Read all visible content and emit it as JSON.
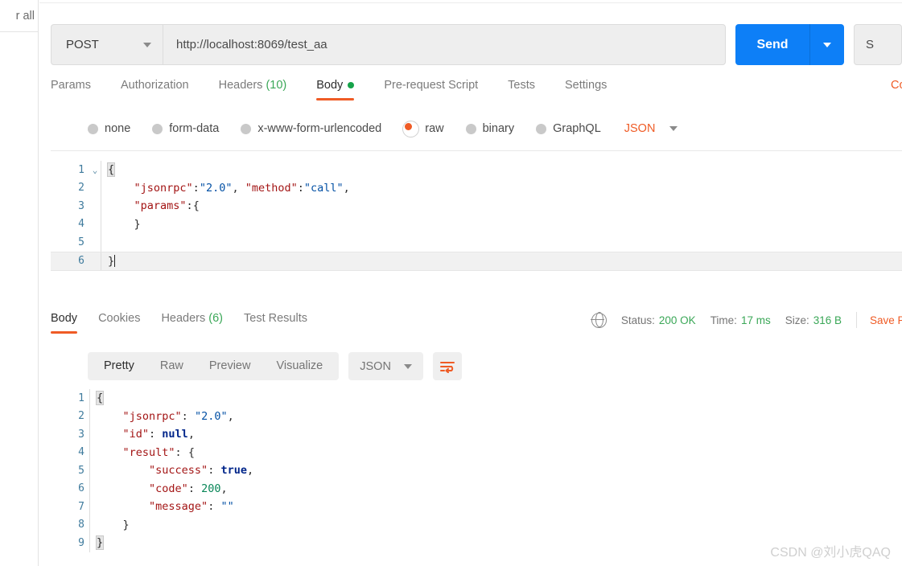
{
  "sidebar": {
    "truncated_label": "r all"
  },
  "request": {
    "method": "POST",
    "url": "http://localhost:8069/test_aa",
    "send_label": "Send",
    "save_label": "S",
    "tabs": [
      {
        "label": "Params",
        "active": false
      },
      {
        "label": "Authorization",
        "active": false
      },
      {
        "label": "Headers",
        "count": "(10)",
        "active": false
      },
      {
        "label": "Body",
        "active": true,
        "dot": true
      },
      {
        "label": "Pre-request Script",
        "active": false
      },
      {
        "label": "Tests",
        "active": false
      },
      {
        "label": "Settings",
        "active": false
      }
    ],
    "cookies_link": "Co",
    "body_types": [
      {
        "label": "none",
        "selected": false
      },
      {
        "label": "form-data",
        "selected": false
      },
      {
        "label": "x-www-form-urlencoded",
        "selected": false
      },
      {
        "label": "raw",
        "selected": true
      },
      {
        "label": "binary",
        "selected": false
      },
      {
        "label": "GraphQL",
        "selected": false
      }
    ],
    "raw_format": "JSON",
    "body_lines": [
      {
        "num": "1",
        "fold": "⌄",
        "tokens": [
          {
            "t": "{",
            "c": "punc",
            "hl": true
          }
        ]
      },
      {
        "num": "2",
        "fold": "",
        "tokens": [
          {
            "t": "    ",
            "c": "punc"
          },
          {
            "t": "\"jsonrpc\"",
            "c": "key"
          },
          {
            "t": ":",
            "c": "punc"
          },
          {
            "t": "\"2.0\"",
            "c": "str"
          },
          {
            "t": ", ",
            "c": "punc"
          },
          {
            "t": "\"method\"",
            "c": "key"
          },
          {
            "t": ":",
            "c": "punc"
          },
          {
            "t": "\"call\"",
            "c": "str"
          },
          {
            "t": ",",
            "c": "punc"
          }
        ]
      },
      {
        "num": "3",
        "fold": "",
        "tokens": [
          {
            "t": "    ",
            "c": "punc"
          },
          {
            "t": "\"params\"",
            "c": "key"
          },
          {
            "t": ":",
            "c": "punc"
          },
          {
            "t": "{",
            "c": "punc"
          }
        ]
      },
      {
        "num": "4",
        "fold": "",
        "tokens": [
          {
            "t": "    ",
            "c": "punc"
          },
          {
            "t": "}",
            "c": "punc"
          }
        ]
      },
      {
        "num": "5",
        "fold": "",
        "tokens": []
      },
      {
        "num": "6",
        "fold": "",
        "active": true,
        "caret": true,
        "tokens": [
          {
            "t": "}",
            "c": "punc"
          }
        ]
      }
    ]
  },
  "response": {
    "tabs": [
      {
        "label": "Body",
        "active": true
      },
      {
        "label": "Cookies",
        "active": false
      },
      {
        "label": "Headers",
        "count": "(6)",
        "active": false
      },
      {
        "label": "Test Results",
        "active": false
      }
    ],
    "status_label": "Status:",
    "status_value": "200 OK",
    "time_label": "Time:",
    "time_value": "17 ms",
    "size_label": "Size:",
    "size_value": "316 B",
    "save_response": "Save R",
    "view_modes": [
      {
        "label": "Pretty",
        "active": true
      },
      {
        "label": "Raw",
        "active": false
      },
      {
        "label": "Preview",
        "active": false
      },
      {
        "label": "Visualize",
        "active": false
      }
    ],
    "format": "JSON",
    "body_lines": [
      {
        "num": "1",
        "tokens": [
          {
            "t": "{",
            "c": "punc",
            "hl": true
          }
        ]
      },
      {
        "num": "2",
        "tokens": [
          {
            "t": "    ",
            "c": "punc"
          },
          {
            "t": "\"jsonrpc\"",
            "c": "key"
          },
          {
            "t": ": ",
            "c": "punc"
          },
          {
            "t": "\"2.0\"",
            "c": "str"
          },
          {
            "t": ",",
            "c": "punc"
          }
        ]
      },
      {
        "num": "3",
        "tokens": [
          {
            "t": "    ",
            "c": "punc"
          },
          {
            "t": "\"id\"",
            "c": "key"
          },
          {
            "t": ": ",
            "c": "punc"
          },
          {
            "t": "null",
            "c": "kw"
          },
          {
            "t": ",",
            "c": "punc"
          }
        ]
      },
      {
        "num": "4",
        "tokens": [
          {
            "t": "    ",
            "c": "punc"
          },
          {
            "t": "\"result\"",
            "c": "key"
          },
          {
            "t": ": ",
            "c": "punc"
          },
          {
            "t": "{",
            "c": "punc"
          }
        ]
      },
      {
        "num": "5",
        "tokens": [
          {
            "t": "        ",
            "c": "punc"
          },
          {
            "t": "\"success\"",
            "c": "key"
          },
          {
            "t": ": ",
            "c": "punc"
          },
          {
            "t": "true",
            "c": "kw"
          },
          {
            "t": ",",
            "c": "punc"
          }
        ]
      },
      {
        "num": "6",
        "tokens": [
          {
            "t": "        ",
            "c": "punc"
          },
          {
            "t": "\"code\"",
            "c": "key"
          },
          {
            "t": ": ",
            "c": "punc"
          },
          {
            "t": "200",
            "c": "num"
          },
          {
            "t": ",",
            "c": "punc"
          }
        ]
      },
      {
        "num": "7",
        "tokens": [
          {
            "t": "        ",
            "c": "punc"
          },
          {
            "t": "\"message\"",
            "c": "key"
          },
          {
            "t": ": ",
            "c": "punc"
          },
          {
            "t": "\"\"",
            "c": "str"
          }
        ]
      },
      {
        "num": "8",
        "tokens": [
          {
            "t": "    ",
            "c": "punc"
          },
          {
            "t": "}",
            "c": "punc"
          }
        ]
      },
      {
        "num": "9",
        "tokens": [
          {
            "t": "}",
            "c": "punc",
            "hl": true
          }
        ]
      }
    ]
  },
  "watermark": "CSDN @刘小虎QAQ",
  "colors": {
    "accent_orange": "#ef5b25",
    "send_blue": "#0d7ff7",
    "status_green": "#3aa757",
    "json_key": "#a31515",
    "json_string": "#0451a5",
    "json_number": "#098658",
    "json_keyword": "#00258a"
  }
}
